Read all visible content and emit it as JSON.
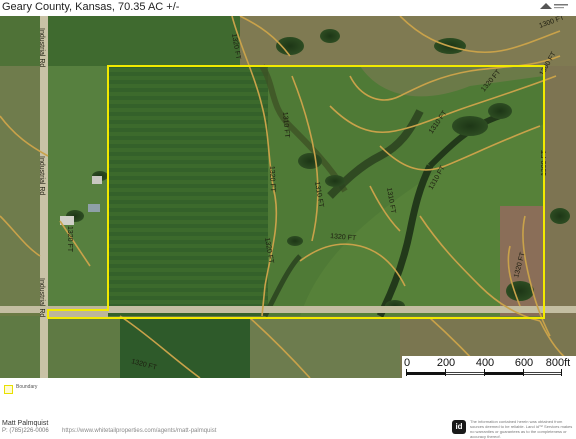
{
  "header": {
    "title": "Geary County, Kansas, 70.35 AC +/-"
  },
  "map": {
    "contour_labels": [
      "1320 FT",
      "1310 FT",
      "1300 FT",
      "1320 FT",
      "1310 FT",
      "1310 FT",
      "1310 FT",
      "1320 FT",
      "1320 FT",
      "1320 FT",
      "1300 FT",
      "1310 FT",
      "1320 FT",
      "1320 FT"
    ],
    "road_labels": [
      "Industrial Rd",
      "Industrial Rd",
      "Industrial Rd"
    ],
    "boundary_color": "#f2ea00",
    "contour_color": "#c9a24a"
  },
  "scale": {
    "labels": [
      "0",
      "200",
      "400",
      "600",
      "800ft"
    ]
  },
  "legend": {
    "label": "Boundary"
  },
  "footer": {
    "agent_name": "Matt Palmquist",
    "agent_phone": "P: (785)226-0006",
    "agent_link": "https://www.whitetailproperties.com/agents/matt-palmquist",
    "logo": "id",
    "disclaimer": "The information contained herein was obtained from sources deemed to be reliable. Land id™ Services makes no warranties or guarantees as to the completeness or accuracy thereof."
  },
  "north_arrow": "N"
}
